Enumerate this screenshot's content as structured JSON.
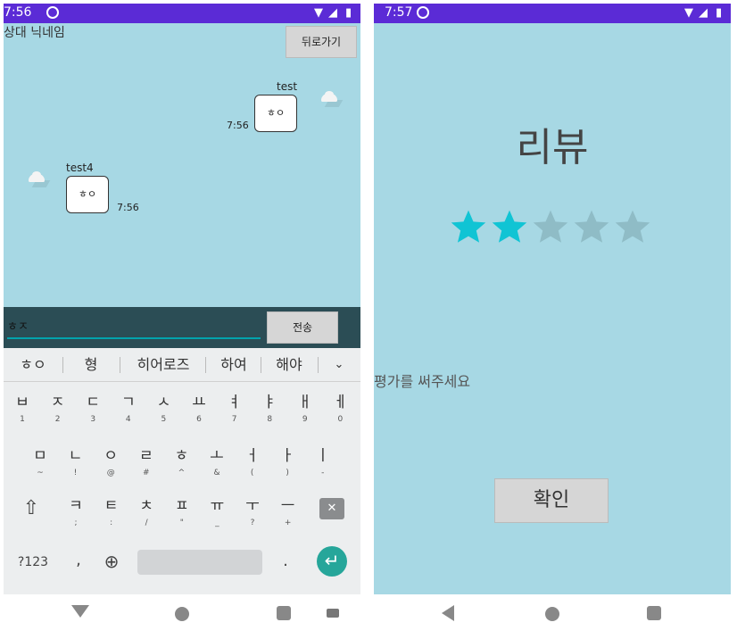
{
  "phone1": {
    "statusbar": {
      "time": "7:56"
    },
    "header": {
      "nickname": "상대 닉네임",
      "back_label": "뒤로가기"
    },
    "messages": [
      {
        "sender": "test",
        "text": "ㅎㅇ",
        "time": "7:56"
      },
      {
        "sender": "test4",
        "text": "ㅎㅇ",
        "time": "7:56"
      }
    ],
    "input": {
      "value": "ㅎㅈ",
      "send_label": "전송"
    },
    "keyboard": {
      "suggestions": [
        "ㅎㅇ",
        "형",
        "히어로즈",
        "하여",
        "해야"
      ],
      "row1": [
        {
          "m": "ㅂ",
          "h": "1"
        },
        {
          "m": "ㅈ",
          "h": "2"
        },
        {
          "m": "ㄷ",
          "h": "3"
        },
        {
          "m": "ㄱ",
          "h": "4"
        },
        {
          "m": "ㅅ",
          "h": "5"
        },
        {
          "m": "ㅛ",
          "h": "6"
        },
        {
          "m": "ㅕ",
          "h": "7"
        },
        {
          "m": "ㅑ",
          "h": "8"
        },
        {
          "m": "ㅐ",
          "h": "9"
        },
        {
          "m": "ㅔ",
          "h": "0"
        }
      ],
      "row2": [
        {
          "m": "ㅁ",
          "h": "~"
        },
        {
          "m": "ㄴ",
          "h": "!"
        },
        {
          "m": "ㅇ",
          "h": "@"
        },
        {
          "m": "ㄹ",
          "h": "#"
        },
        {
          "m": "ㅎ",
          "h": "^"
        },
        {
          "m": "ㅗ",
          "h": "&"
        },
        {
          "m": "ㅓ",
          "h": "("
        },
        {
          "m": "ㅏ",
          "h": ")"
        },
        {
          "m": "ㅣ",
          "h": "-"
        }
      ],
      "row3": [
        {
          "m": "ㅋ",
          "h": ";"
        },
        {
          "m": "ㅌ",
          "h": ":"
        },
        {
          "m": "ㅊ",
          "h": "/"
        },
        {
          "m": "ㅍ",
          "h": "\""
        },
        {
          "m": "ㅠ",
          "h": "_"
        },
        {
          "m": "ㅜ",
          "h": "?"
        },
        {
          "m": "ㅡ",
          "h": "+"
        }
      ],
      "symbols_label": "?123",
      "comma": ",",
      "period": "."
    }
  },
  "phone2": {
    "statusbar": {
      "time": "7:57"
    },
    "title": "리뷰",
    "rating": {
      "value": 2,
      "max": 5,
      "filled_color": "#10c4d4",
      "empty_color": "#8fbcc6"
    },
    "hint": "평가를 써주세요",
    "confirm_label": "확인"
  }
}
